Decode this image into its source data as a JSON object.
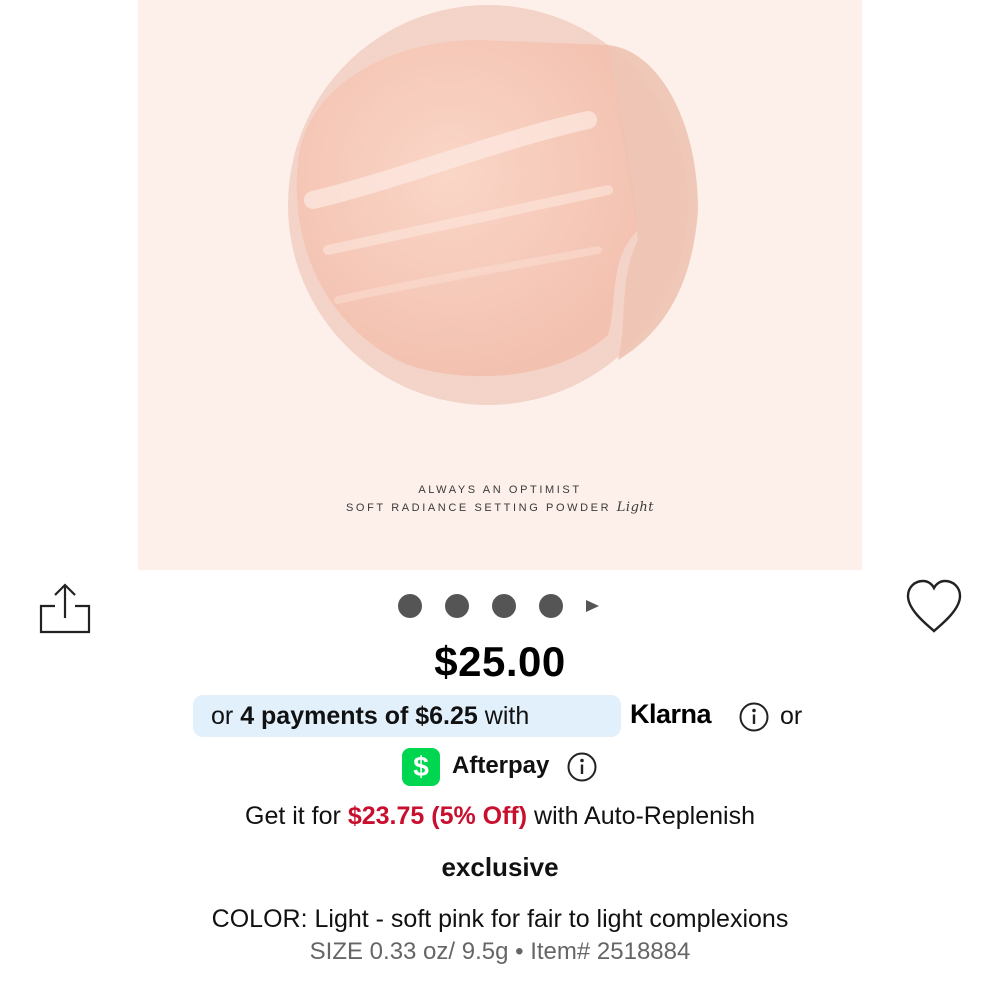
{
  "product_image": {
    "caption_line1": "ALWAYS AN OPTIMIST",
    "caption_line2": "SOFT RADIANCE SETTING POWDER",
    "caption_script": "Light",
    "powder_color": "#f6c9b9",
    "background_color": "#fdf0ea"
  },
  "actions": {
    "share_icon": "share-icon",
    "favorite_icon": "heart-icon"
  },
  "carousel": {
    "dot_count": 4,
    "next_icon": "play-triangle-icon"
  },
  "price": "$25.00",
  "klarna": {
    "prefix": "or",
    "payments": "4 payments of $6.25",
    "with": "with",
    "brand": "Klarna",
    "suffix": "or",
    "pill_color": "#e2f0fb"
  },
  "afterpay": {
    "icon_glyph": "$",
    "label": "Afterpay",
    "icon_color": "#00d64f"
  },
  "auto_replenish": {
    "prefix": "Get it for",
    "offer": "$23.75 (5% Off)",
    "suffix": "with Auto-Replenish",
    "offer_color": "#c8102e"
  },
  "badge": "exclusive",
  "color_line": {
    "label": "COLOR:",
    "value": "Light - soft pink for fair to light complexions"
  },
  "size_line": {
    "label": "SIZE",
    "value": "0.33 oz/ 9.5g",
    "separator": "•",
    "item_label": "Item#",
    "item_number": "2518884"
  }
}
